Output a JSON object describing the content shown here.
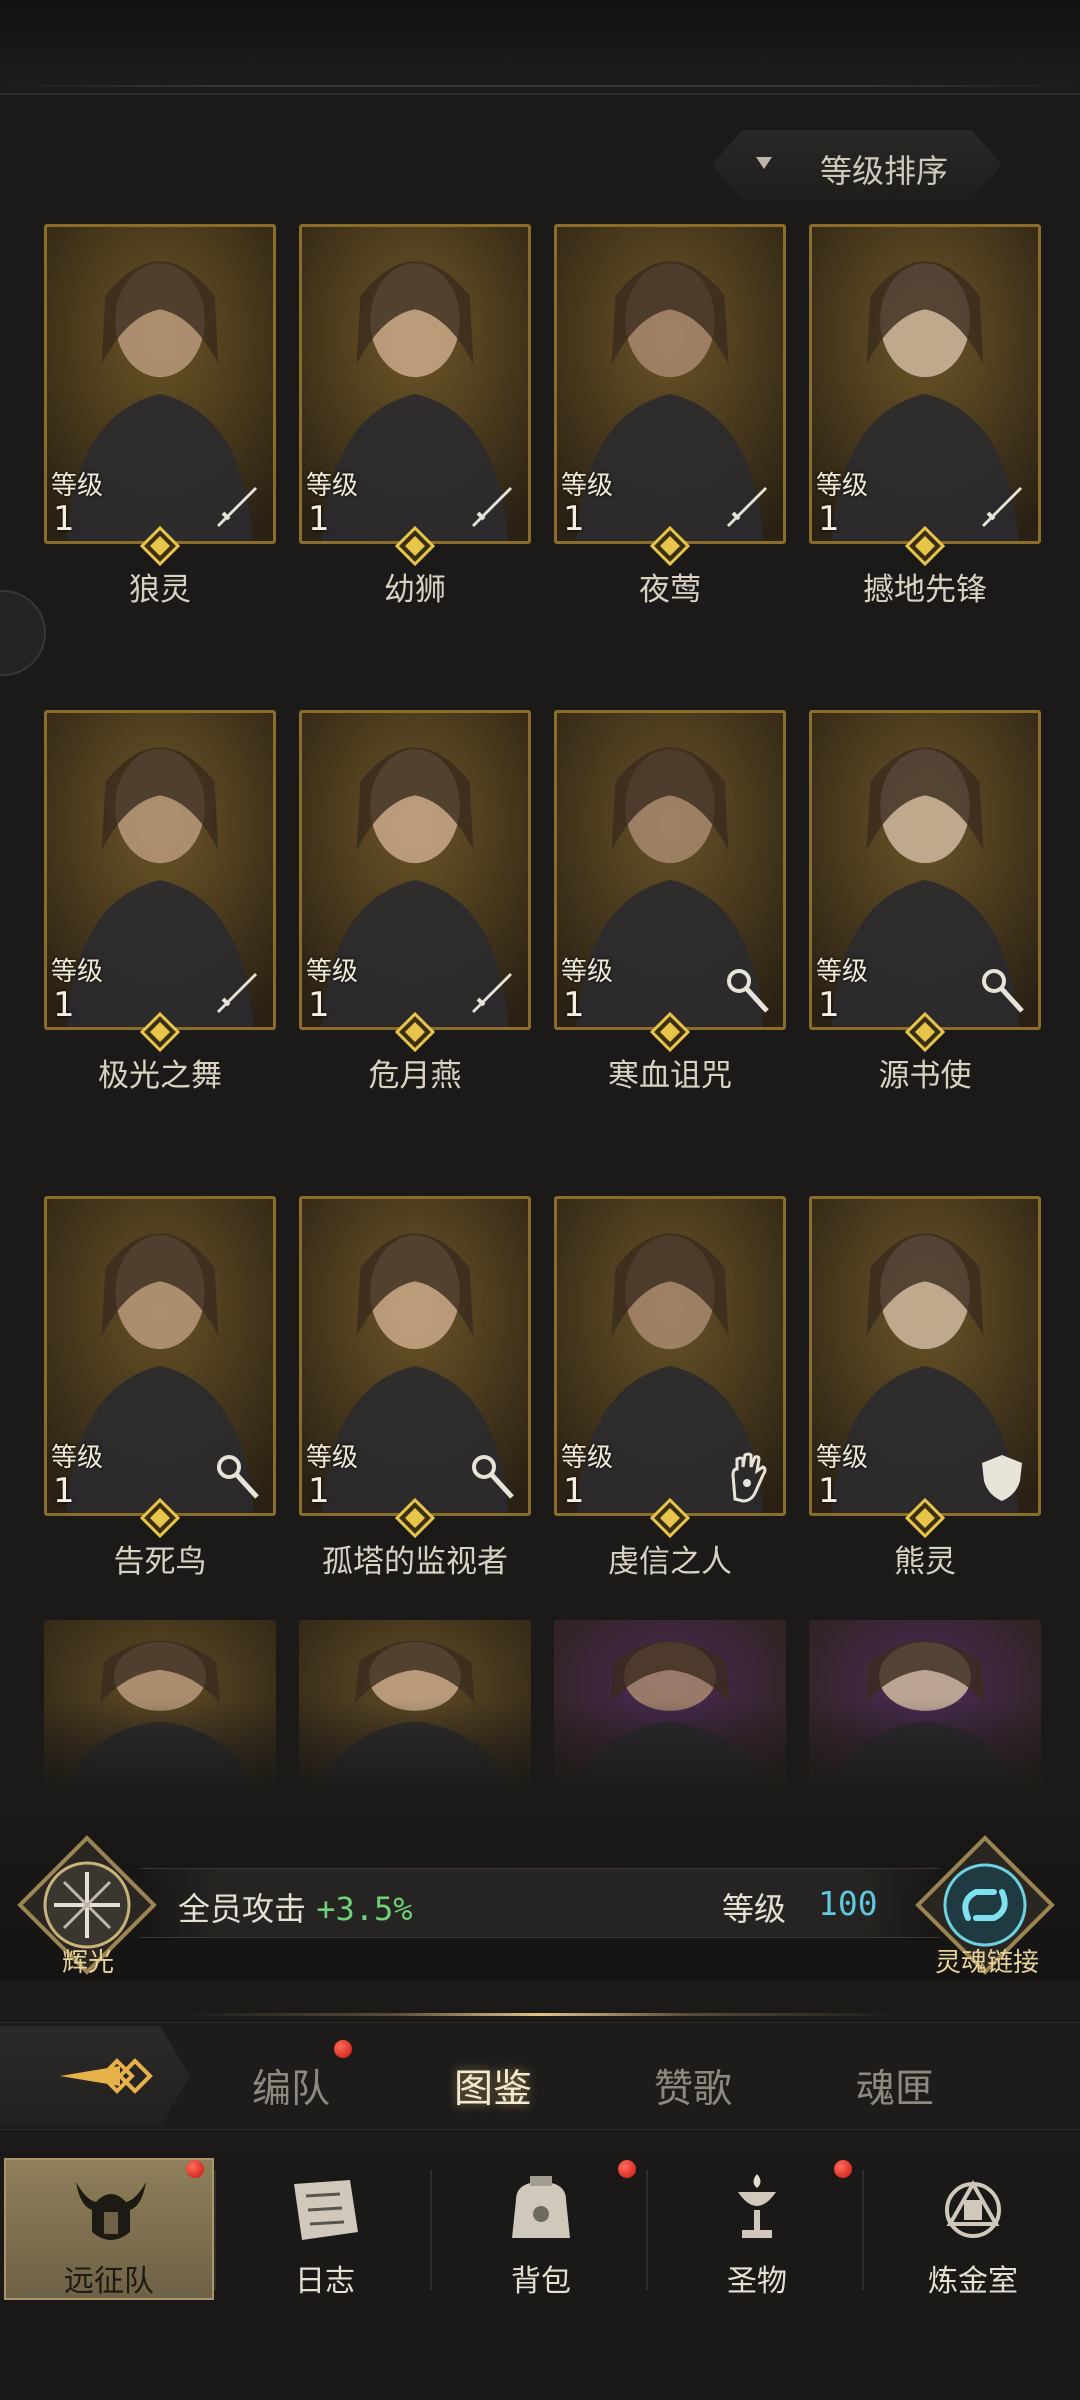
{
  "sort": {
    "label": "等级排序"
  },
  "level_label": "等级",
  "heroes": [
    {
      "name": "狼灵",
      "level": "1",
      "class_icon": "sword-icon",
      "bg": "#6b5425"
    },
    {
      "name": "幼狮",
      "level": "1",
      "class_icon": "sword-icon",
      "bg": "#6e5627"
    },
    {
      "name": "夜莺",
      "level": "1",
      "class_icon": "sword-icon",
      "bg": "#6a5326"
    },
    {
      "name": "撼地先锋",
      "level": "1",
      "class_icon": "sword-icon",
      "bg": "#6c5527"
    },
    {
      "name": "极光之舞",
      "level": "1",
      "class_icon": "sword-icon",
      "bg": "#6d5628"
    },
    {
      "name": "危月燕",
      "level": "1",
      "class_icon": "sword-icon",
      "bg": "#6b5426"
    },
    {
      "name": "寒血诅咒",
      "level": "1",
      "class_icon": "staff-icon",
      "bg": "#675227"
    },
    {
      "name": "源书使",
      "level": "1",
      "class_icon": "staff-icon",
      "bg": "#6a5428"
    },
    {
      "name": "告死鸟",
      "level": "1",
      "class_icon": "staff-icon",
      "bg": "#665126"
    },
    {
      "name": "孤塔的监视者",
      "level": "1",
      "class_icon": "staff-icon",
      "bg": "#6b5427"
    },
    {
      "name": "虔信之人",
      "level": "1",
      "class_icon": "hand-icon",
      "bg": "#685327"
    },
    {
      "name": "熊灵",
      "level": "1",
      "class_icon": "shield-icon",
      "bg": "#6a5428"
    }
  ],
  "partial_row": [
    {
      "bg": "#5f4c26"
    },
    {
      "bg": "#614d27"
    },
    {
      "bg": "#4a2a55"
    },
    {
      "bg": "#4b2b58"
    }
  ],
  "bonus": {
    "left_emblem_label": "辉光",
    "stat_text": "全员攻击",
    "stat_value": "+3.5%",
    "level_label": "等级",
    "level_value": "100",
    "right_emblem_label": "灵魂链接"
  },
  "subtabs": [
    {
      "label": "编队",
      "badge": true,
      "active": false
    },
    {
      "label": "图鉴",
      "badge": false,
      "active": true
    },
    {
      "label": "赞歌",
      "badge": false,
      "active": false
    },
    {
      "label": "魂匣",
      "badge": false,
      "active": false
    }
  ],
  "nav": [
    {
      "label": "远征队",
      "icon": "helmet-icon",
      "active": true,
      "badge": true
    },
    {
      "label": "日志",
      "icon": "map-icon",
      "active": false,
      "badge": false
    },
    {
      "label": "背包",
      "icon": "bag-icon",
      "active": false,
      "badge": true
    },
    {
      "label": "圣物",
      "icon": "chalice-icon",
      "active": false,
      "badge": true
    },
    {
      "label": "炼金室",
      "icon": "alchemy-icon",
      "active": false,
      "badge": false
    }
  ],
  "colors": {
    "card_border": "#8a6d2b",
    "gem": "#e6c54a",
    "bonus_value": "#6ed07a",
    "level_value": "#5fc7dd",
    "badge": "#d21d14"
  }
}
